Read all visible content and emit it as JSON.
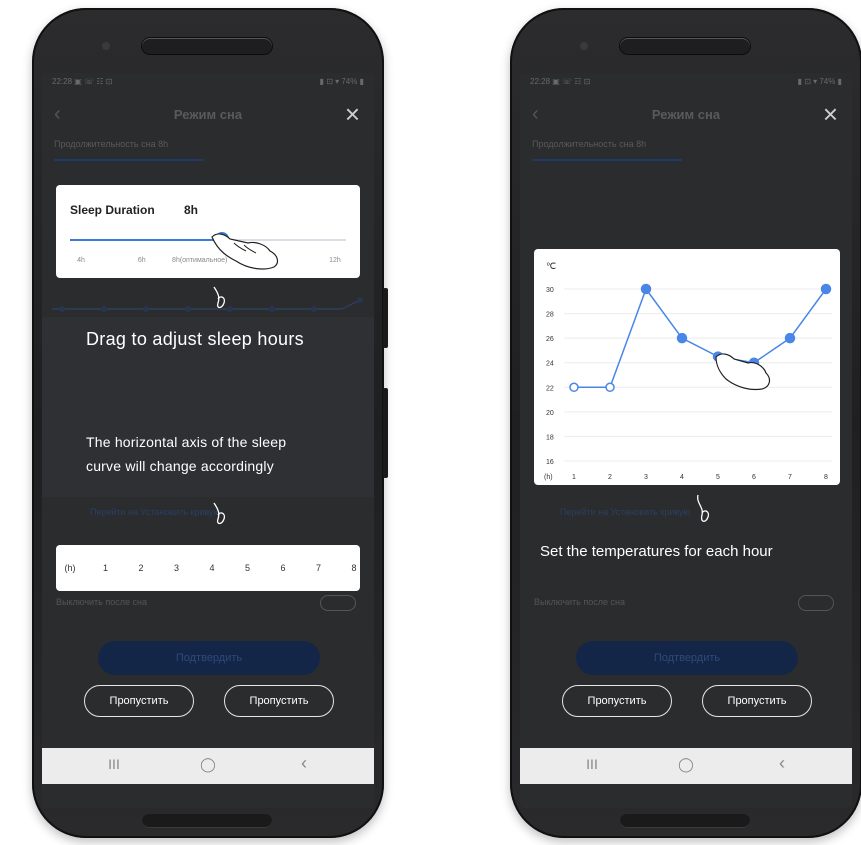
{
  "screen1": {
    "status_time": "22:28 ▣ ☏ ☷ ⊡",
    "status_right": "▮ ⊡ ▾ 74% ▮",
    "title": "Режим сна",
    "subtitle": "Продолжительность сна 8h",
    "slider_card": {
      "label": "Sleep Duration",
      "value": "8h",
      "level_fraction": 0.55,
      "ticks": [
        "4h",
        "6h",
        "8h(оптимальное)",
        "10h",
        "12h"
      ]
    },
    "hint_drag": "Drag to adjust sleep hours",
    "hint_axis_line1": "The horizontal axis of the sleep",
    "hint_axis_line2": "curve will change accordingly",
    "link_text": "Перейти на Установить кривую",
    "axis_card": {
      "unit": "(h)",
      "hours": [
        "1",
        "2",
        "3",
        "4",
        "5",
        "6",
        "7",
        "8"
      ]
    },
    "toggle_label": "Выключить после сна",
    "confirm_label": "Подтвердить",
    "skip_left": "Пропустить",
    "skip_right": "Пропустить",
    "nav": {
      "recent": "III",
      "home": "◯",
      "back": "‹"
    }
  },
  "screen2": {
    "status_time": "22:28 ▣ ☏ ☷ ⊡",
    "status_right": "▮ ⊡ ▾ 74% ▮",
    "title": "Режим сна",
    "subtitle": "Продолжительность сна 8h",
    "chart_data": {
      "type": "line",
      "ylabel": "℃",
      "xlabel": "(h)",
      "categories": [
        "1",
        "2",
        "3",
        "4",
        "5",
        "6",
        "7",
        "8"
      ],
      "y_ticks": [
        "30",
        "28",
        "26",
        "24",
        "22",
        "20",
        "18",
        "16"
      ],
      "ylim": [
        16,
        30
      ],
      "series": [
        {
          "values": [
            22,
            22,
            30,
            26,
            24.5,
            24,
            26,
            30
          ],
          "open_points": [
            0,
            1
          ],
          "color": "#4a86e8"
        }
      ],
      "grid": true
    },
    "link_text": "Перейти на Установить кривую",
    "hint_temps": "Set the temperatures for each hour",
    "toggle_label": "Выключить после сна",
    "confirm_label": "Подтвердить",
    "skip_left": "Пропустить",
    "skip_right": "Пропустить",
    "nav": {
      "recent": "III",
      "home": "◯",
      "back": "‹"
    }
  }
}
